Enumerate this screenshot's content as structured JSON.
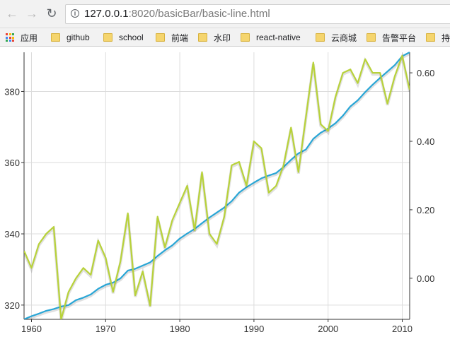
{
  "browser": {
    "address_host": "127.0.0.1",
    "address_path": ":8020/basicBar/basic-line.html",
    "bookmarks": [
      "应用",
      "github",
      "school",
      "前端",
      "水印",
      "react-native",
      "云商城",
      "告警平台",
      "持"
    ]
  },
  "colors": {
    "co2_line": "#29a6d6",
    "temp_line": "#b8d23a",
    "grid": "#dcdcdc",
    "axis": "#333333"
  },
  "chart_data": {
    "type": "line",
    "title": "",
    "xlabel": "",
    "ylabel": "",
    "grid": true,
    "x_range": [
      1959,
      2011
    ],
    "left_axis": {
      "range": [
        316,
        391
      ],
      "ticks": [
        "320",
        "340",
        "360",
        "380"
      ]
    },
    "right_axis": {
      "range": [
        -0.12,
        0.66
      ],
      "ticks": [
        "0.00",
        "0.20",
        "0.40",
        "0.60"
      ]
    },
    "x_ticks": [
      "1960",
      "1970",
      "1980",
      "1990",
      "2000",
      "2010"
    ],
    "series": [
      {
        "axis": "left",
        "x": [
          1959,
          1960,
          1961,
          1962,
          1963,
          1964,
          1965,
          1966,
          1967,
          1968,
          1969,
          1970,
          1971,
          1972,
          1973,
          1974,
          1975,
          1976,
          1977,
          1978,
          1979,
          1980,
          1981,
          1982,
          1983,
          1984,
          1985,
          1986,
          1987,
          1988,
          1989,
          1990,
          1991,
          1992,
          1993,
          1994,
          1995,
          1996,
          1997,
          1998,
          1999,
          2000,
          2001,
          2002,
          2003,
          2004,
          2005,
          2006,
          2007,
          2008,
          2009,
          2010,
          2011
        ],
        "values": [
          316.0,
          316.9,
          317.6,
          318.4,
          318.9,
          319.6,
          320.0,
          321.4,
          322.1,
          323.0,
          324.6,
          325.7,
          326.3,
          327.5,
          329.7,
          330.2,
          331.1,
          332.0,
          333.8,
          335.4,
          336.8,
          338.7,
          340.1,
          341.4,
          343.0,
          344.6,
          346.0,
          347.4,
          349.2,
          351.6,
          353.1,
          354.4,
          355.6,
          356.4,
          357.1,
          358.8,
          360.8,
          362.6,
          363.7,
          366.7,
          368.4,
          369.6,
          371.1,
          373.2,
          375.8,
          377.5,
          379.8,
          381.9,
          383.8,
          385.6,
          387.4,
          389.9,
          391.0
        ]
      },
      {
        "axis": "right",
        "x": [
          1959,
          1960,
          1961,
          1962,
          1963,
          1964,
          1965,
          1966,
          1967,
          1968,
          1969,
          1970,
          1971,
          1972,
          1973,
          1974,
          1975,
          1976,
          1977,
          1978,
          1979,
          1980,
          1981,
          1982,
          1983,
          1984,
          1985,
          1986,
          1987,
          1988,
          1989,
          1990,
          1991,
          1992,
          1993,
          1994,
          1995,
          1996,
          1997,
          1998,
          1999,
          2000,
          2001,
          2002,
          2003,
          2004,
          2005,
          2006,
          2007,
          2008,
          2009,
          2010,
          2011
        ],
        "values": [
          0.08,
          0.03,
          0.1,
          0.13,
          0.15,
          -0.12,
          -0.04,
          0.0,
          0.03,
          0.01,
          0.11,
          0.06,
          -0.04,
          0.05,
          0.19,
          -0.05,
          0.02,
          -0.08,
          0.18,
          0.09,
          0.17,
          0.22,
          0.27,
          0.14,
          0.31,
          0.13,
          0.1,
          0.18,
          0.33,
          0.34,
          0.27,
          0.4,
          0.38,
          0.25,
          0.27,
          0.33,
          0.44,
          0.31,
          0.47,
          0.63,
          0.45,
          0.43,
          0.53,
          0.6,
          0.61,
          0.57,
          0.64,
          0.6,
          0.6,
          0.51,
          0.59,
          0.65,
          0.55
        ]
      }
    ]
  }
}
